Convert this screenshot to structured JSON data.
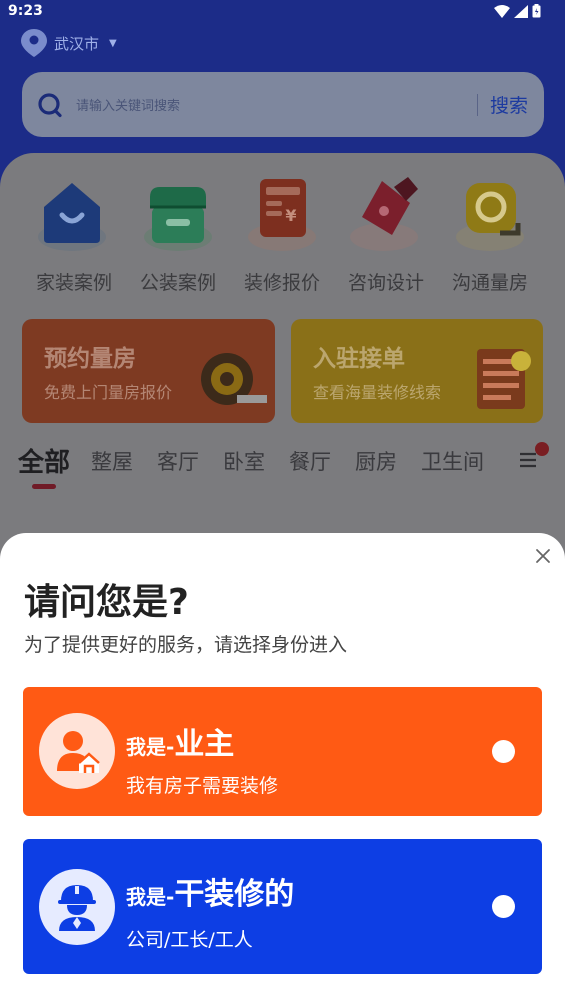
{
  "status_bar": {
    "time": "9:23"
  },
  "location": {
    "city": "武汉市"
  },
  "search": {
    "placeholder": "请输入关键词搜索",
    "button_label": "搜索"
  },
  "categories": [
    {
      "label": "家装案例",
      "icon": "house-icon"
    },
    {
      "label": "公装案例",
      "icon": "shop-icon"
    },
    {
      "label": "装修报价",
      "icon": "quote-calculator-icon"
    },
    {
      "label": "咨询设计",
      "icon": "design-pen-icon"
    },
    {
      "label": "沟通量房",
      "icon": "tape-measure-icon"
    }
  ],
  "promos": [
    {
      "title": "预约量房",
      "subtitle": "免费上门量房报价",
      "icon": "tape-measure-icon"
    },
    {
      "title": "入驻接单",
      "subtitle": "查看海量装修线索",
      "icon": "order-list-icon"
    }
  ],
  "tabs": [
    "全部",
    "整屋",
    "客厅",
    "卧室",
    "餐厅",
    "厨房",
    "卫生间"
  ],
  "dialog": {
    "title": "请问您是?",
    "subtitle": "为了提供更好的服务，请选择身份进入",
    "options": [
      {
        "prefix": "我是-",
        "name": "业主",
        "desc": "我有房子需要装修",
        "color": "#ff5a14"
      },
      {
        "prefix": "我是-",
        "name": "干装修的",
        "desc": "公司/工长/工人",
        "color": "#0d3ee4"
      }
    ]
  },
  "colors": {
    "accent_orange": "#ff5a14",
    "accent_blue": "#0d3ee4",
    "header_bg": "#1c2c88"
  }
}
